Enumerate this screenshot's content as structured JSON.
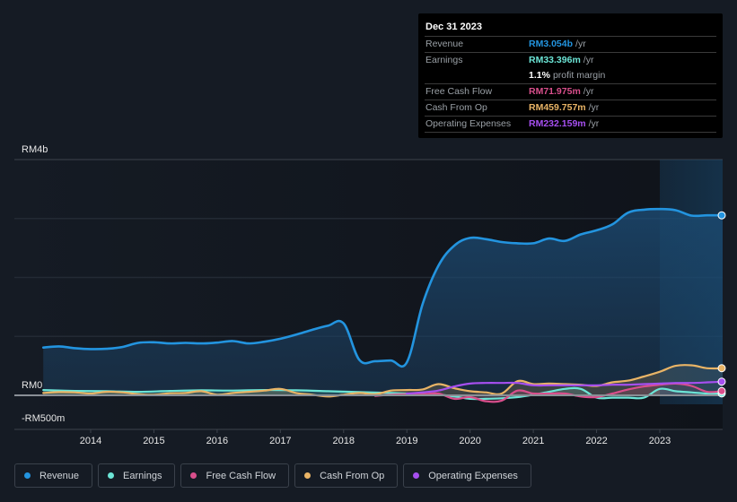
{
  "tooltip": {
    "date": "Dec 31 2023",
    "rows": [
      {
        "label": "Revenue",
        "value": "RM3.054b",
        "unit": "/yr",
        "color": "#2394df"
      },
      {
        "label": "Earnings",
        "value": "RM33.396m",
        "unit": "/yr",
        "color": "#6ce5d6"
      },
      {
        "label": "",
        "value": "1.1%",
        "unit": "profit margin",
        "color": "#ffffff"
      },
      {
        "label": "Free Cash Flow",
        "value": "RM71.975m",
        "unit": "/yr",
        "color": "#d94f8c"
      },
      {
        "label": "Cash From Op",
        "value": "RM459.757m",
        "unit": "/yr",
        "color": "#e9b466"
      },
      {
        "label": "Operating Expenses",
        "value": "RM232.159m",
        "unit": "/yr",
        "color": "#a64ff0"
      }
    ]
  },
  "legend": [
    {
      "label": "Revenue",
      "color": "#2394df"
    },
    {
      "label": "Earnings",
      "color": "#6ce5d6"
    },
    {
      "label": "Free Cash Flow",
      "color": "#d94f8c"
    },
    {
      "label": "Cash From Op",
      "color": "#e9b466"
    },
    {
      "label": "Operating Expenses",
      "color": "#a64ff0"
    }
  ],
  "chart_data": {
    "type": "area",
    "title": "",
    "xlabel": "",
    "ylabel": "",
    "y_unit": "RM",
    "ylim": [
      -500,
      4000
    ],
    "xlim": [
      2012.8,
      2024.0
    ],
    "y_tick_labels": [
      {
        "value": 4000,
        "label": "RM4b"
      },
      {
        "value": 0,
        "label": "RM0"
      },
      {
        "value": -500,
        "label": "-RM500m"
      }
    ],
    "gridlines": [
      3000,
      2000,
      1000
    ],
    "x_tick_labels": [
      "2014",
      "2015",
      "2016",
      "2017",
      "2018",
      "2019",
      "2020",
      "2021",
      "2022",
      "2023"
    ],
    "x_tick_values": [
      2014,
      2015,
      2016,
      2017,
      2018,
      2019,
      2020,
      2021,
      2022,
      2023
    ],
    "highlight_start": 2023.0,
    "series": [
      {
        "name": "Revenue",
        "color": "#2394df",
        "fill": true,
        "x": [
          2013.25,
          2013.5,
          2013.75,
          2014.0,
          2014.25,
          2014.5,
          2014.75,
          2015.0,
          2015.25,
          2015.5,
          2015.75,
          2016.0,
          2016.25,
          2016.5,
          2016.75,
          2017.0,
          2017.25,
          2017.5,
          2017.75,
          2018.0,
          2018.25,
          2018.5,
          2018.75,
          2019.0,
          2019.25,
          2019.5,
          2019.75,
          2020.0,
          2020.25,
          2020.5,
          2020.75,
          2021.0,
          2021.25,
          2021.5,
          2021.75,
          2022.0,
          2022.25,
          2022.5,
          2022.75,
          2023.0,
          2023.25,
          2023.5,
          2023.75,
          2024.0
        ],
        "values": [
          810,
          830,
          800,
          785,
          790,
          820,
          890,
          900,
          880,
          890,
          880,
          895,
          920,
          880,
          910,
          960,
          1030,
          1110,
          1180,
          1220,
          600,
          580,
          590,
          560,
          1550,
          2200,
          2540,
          2670,
          2650,
          2600,
          2580,
          2580,
          2660,
          2620,
          2730,
          2800,
          2900,
          3100,
          3150,
          3160,
          3140,
          3050,
          3054,
          3054
        ]
      },
      {
        "name": "Earnings",
        "color": "#6ce5d6",
        "fill": true,
        "x": [
          2013.25,
          2013.75,
          2014.25,
          2014.75,
          2015.25,
          2015.75,
          2016.25,
          2016.75,
          2017.25,
          2017.75,
          2018.25,
          2018.75,
          2019.0,
          2019.5,
          2019.75,
          2020.0,
          2020.25,
          2020.5,
          2020.75,
          2021.0,
          2021.25,
          2021.5,
          2021.75,
          2022.0,
          2022.25,
          2022.5,
          2022.75,
          2023.0,
          2023.25,
          2023.5,
          2023.75,
          2024.0
        ],
        "values": [
          90,
          75,
          70,
          60,
          75,
          85,
          80,
          90,
          85,
          70,
          55,
          40,
          30,
          10,
          -20,
          -60,
          -60,
          -50,
          -30,
          10,
          60,
          110,
          110,
          -40,
          -40,
          -40,
          -40,
          110,
          70,
          50,
          30,
          33
        ]
      },
      {
        "name": "Free Cash Flow",
        "color": "#d94f8c",
        "fill": true,
        "x": [
          2018.5,
          2018.75,
          2019.0,
          2019.25,
          2019.5,
          2019.75,
          2020.0,
          2020.25,
          2020.5,
          2020.75,
          2021.0,
          2021.25,
          2021.5,
          2021.75,
          2022.0,
          2022.25,
          2022.5,
          2022.75,
          2023.0,
          2023.25,
          2023.5,
          2023.75,
          2024.0
        ],
        "values": [
          -10,
          10,
          20,
          20,
          30,
          -60,
          -30,
          -100,
          -90,
          80,
          30,
          30,
          30,
          -20,
          -30,
          30,
          100,
          150,
          180,
          200,
          160,
          60,
          72
        ]
      },
      {
        "name": "Cash From Op",
        "color": "#e9b466",
        "fill": true,
        "x": [
          2013.25,
          2013.5,
          2013.75,
          2014.0,
          2014.25,
          2014.5,
          2014.75,
          2015.0,
          2015.25,
          2015.5,
          2015.75,
          2016.0,
          2016.25,
          2016.5,
          2016.75,
          2017.0,
          2017.25,
          2017.5,
          2017.75,
          2018.0,
          2018.25,
          2018.5,
          2018.75,
          2019.0,
          2019.25,
          2019.5,
          2019.75,
          2020.0,
          2020.25,
          2020.5,
          2020.75,
          2021.0,
          2021.25,
          2021.5,
          2021.75,
          2022.0,
          2022.25,
          2022.5,
          2022.75,
          2023.0,
          2023.25,
          2023.5,
          2023.75,
          2024.0
        ],
        "values": [
          40,
          55,
          50,
          30,
          60,
          50,
          20,
          10,
          35,
          40,
          70,
          10,
          40,
          60,
          80,
          110,
          40,
          10,
          -20,
          10,
          40,
          20,
          80,
          90,
          100,
          190,
          120,
          70,
          50,
          30,
          240,
          190,
          200,
          190,
          180,
          160,
          220,
          250,
          320,
          400,
          500,
          510,
          460,
          460
        ]
      },
      {
        "name": "Operating Expenses",
        "color": "#a64ff0",
        "fill": false,
        "x": [
          2019.0,
          2019.25,
          2019.5,
          2019.75,
          2020.0,
          2020.25,
          2020.5,
          2020.75,
          2021.0,
          2021.25,
          2021.5,
          2021.75,
          2022.0,
          2022.25,
          2022.5,
          2022.75,
          2023.0,
          2023.25,
          2023.5,
          2023.75,
          2024.0
        ],
        "values": [
          30,
          50,
          80,
          150,
          200,
          210,
          210,
          210,
          170,
          170,
          170,
          170,
          170,
          180,
          180,
          190,
          200,
          210,
          210,
          220,
          232
        ]
      }
    ]
  }
}
